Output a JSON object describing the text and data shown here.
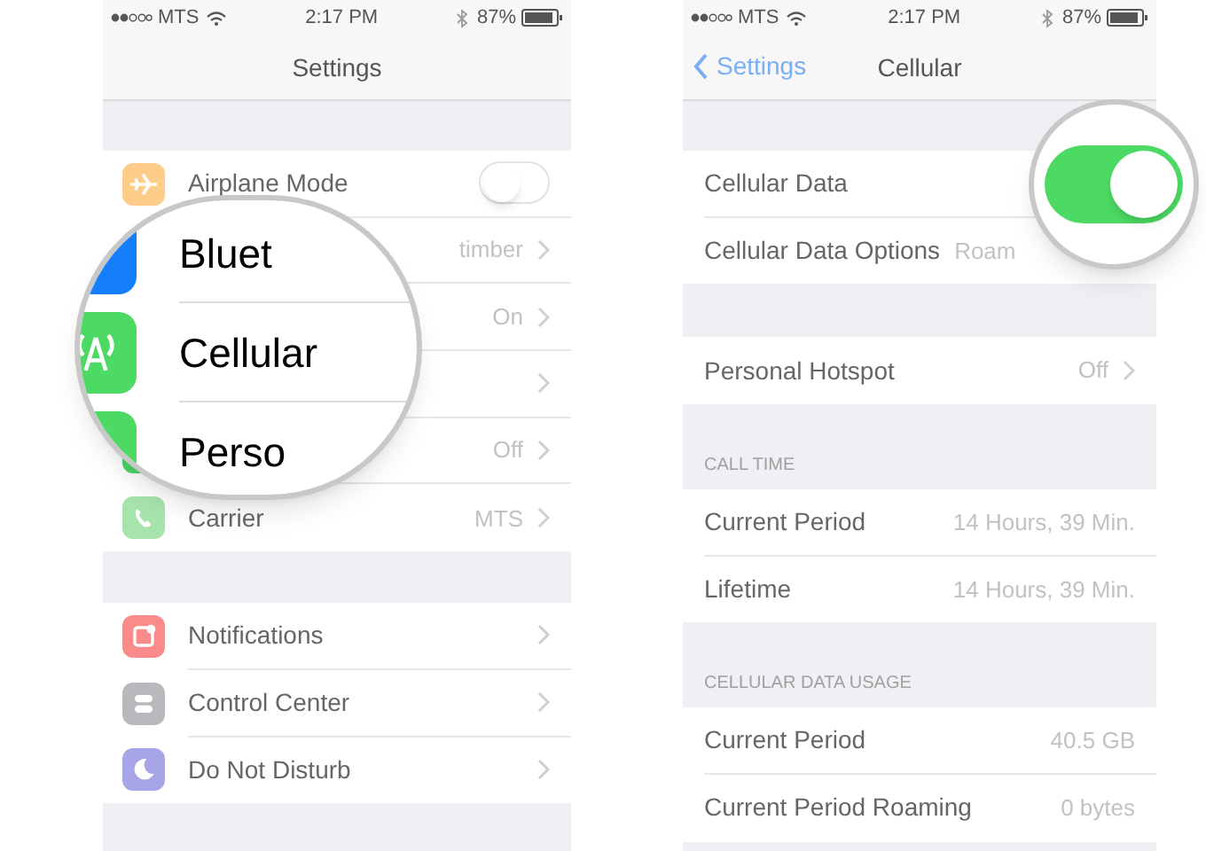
{
  "screens": [
    {
      "status_bar": {
        "carrier": "MTS",
        "time": "2:17 PM",
        "battery": "87%"
      },
      "nav": {
        "title": "Settings"
      },
      "sections": [
        {
          "rows": [
            {
              "kind": "toggle",
              "label": "Airplane Mode",
              "on": false
            },
            {
              "kind": "link",
              "value": "timber"
            },
            {
              "kind": "link",
              "value": "On"
            },
            {
              "kind": "link"
            },
            {
              "kind": "link",
              "value": "Off"
            },
            {
              "kind": "link",
              "label": "Carrier",
              "value": "MTS"
            }
          ]
        },
        {
          "rows": [
            {
              "kind": "link",
              "label": "Notifications"
            },
            {
              "kind": "link",
              "label": "Control Center"
            },
            {
              "kind": "link",
              "label": "Do Not Disturb"
            }
          ]
        }
      ],
      "magnifier": {
        "kind": "rows",
        "rows": [
          {
            "label": "Bluet"
          },
          {
            "label": "Cellular"
          },
          {
            "label": "Perso"
          }
        ]
      }
    },
    {
      "status_bar": {
        "carrier": "MTS",
        "time": "2:17 PM",
        "battery": "87%"
      },
      "nav": {
        "title": "Cellular",
        "back": "Settings"
      },
      "sections": [
        {
          "rows": [
            {
              "kind": "plain",
              "label": "Cellular Data"
            },
            {
              "kind": "inline",
              "label": "Cellular Data Options",
              "value": "Roam"
            }
          ]
        },
        {
          "rows": [
            {
              "kind": "link",
              "label": "Personal Hotspot",
              "value": "Off"
            }
          ]
        },
        {
          "header": "CALL TIME",
          "rows": [
            {
              "kind": "plain",
              "label": "Current Period",
              "value": "14 Hours, 39 Min."
            },
            {
              "kind": "plain",
              "label": "Lifetime",
              "value": "14 Hours, 39 Min."
            }
          ]
        },
        {
          "header": "CELLULAR DATA USAGE",
          "rows": [
            {
              "kind": "plain",
              "label": "Current Period",
              "value": "40.5 GB"
            },
            {
              "kind": "plain",
              "label": "Current Period Roaming",
              "value": "0 bytes"
            }
          ]
        }
      ],
      "magnifier": {
        "kind": "toggle",
        "on": true
      }
    }
  ]
}
